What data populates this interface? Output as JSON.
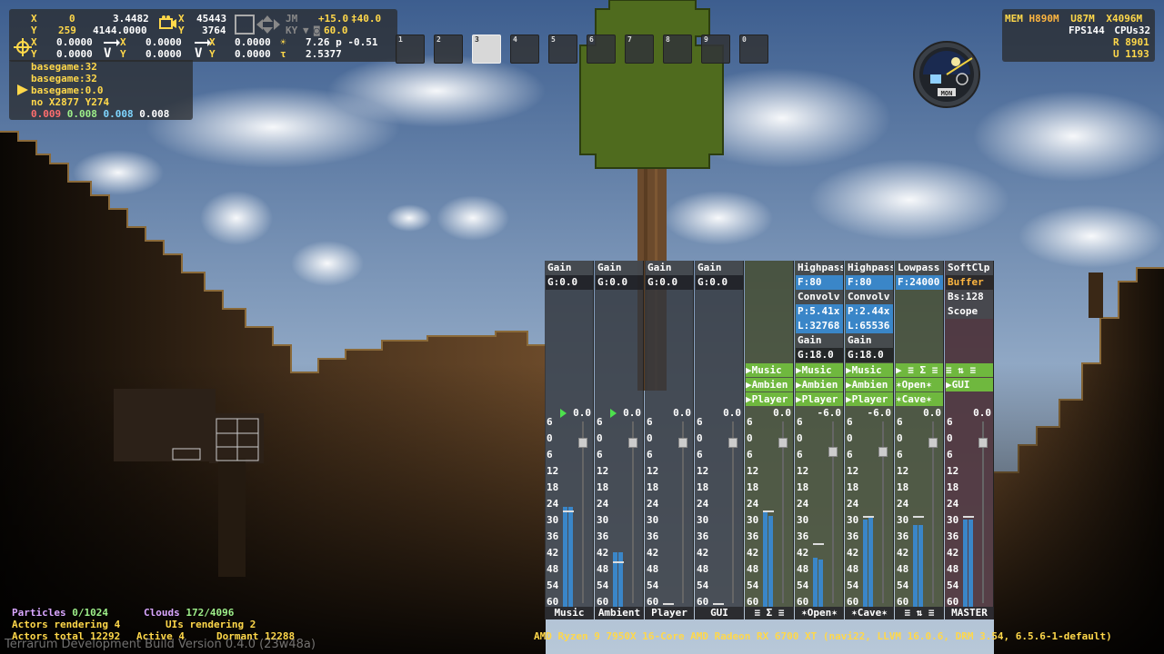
{
  "debug": {
    "row1": {
      "x_label": "X",
      "x_a": "0",
      "x_b": "3.4482",
      "y_label": "Y",
      "y_a": "259",
      "y_b": "4144.0000"
    },
    "row2": {
      "x_label": "X",
      "x_val": "0.0000",
      "y_label": "Y",
      "y_val": "0.0000"
    },
    "cam": {
      "x_label": "X",
      "x_val": "45443",
      "y_label": "Y",
      "y_val": "3764"
    },
    "jm": "JM",
    "ky": "KY",
    "vel1": {
      "x_val": "0.0000",
      "y_val": "0.0000"
    },
    "vel2": {
      "x_val": "0.0000",
      "y_val": "0.0000"
    },
    "wx_a": "+15.0",
    "wx_b": "‡40.0",
    "wx_c": "60.0",
    "time1": "7.26 p -0.51",
    "time2": "2.5377",
    "lines": [
      "basegame:32",
      "basegame:32",
      "basegame:0.0"
    ],
    "tile": "no X2877 Y274",
    "timings": [
      "0.009",
      "0.008",
      "0.008",
      "0.008"
    ]
  },
  "stats": {
    "mem_label": "MEM",
    "mem_h": "H890M",
    "mem_u": "U87M",
    "mem_x": "X4096M",
    "fps": "FPS144",
    "cpus": "CPUs32",
    "r": "R 8901",
    "u": "U 1193"
  },
  "clock": {
    "label": "MON"
  },
  "quickslots": [
    "1",
    "2",
    "3",
    "4",
    "5",
    "6",
    "7",
    "8",
    "9",
    "0"
  ],
  "quickslot_selected": 2,
  "mixer": {
    "strips": [
      {
        "name": "Music",
        "fx": [
          {
            "t": "Gain",
            "s": "h"
          },
          {
            "t": "G:0.0",
            "s": "v"
          }
        ],
        "sends": [],
        "db": "0.0",
        "play": true,
        "fader": 0.05,
        "meterL": 0.55,
        "meterR": 0.55,
        "peak": 0.53
      },
      {
        "name": "Ambient",
        "fx": [
          {
            "t": "Gain",
            "s": "h"
          },
          {
            "t": "G:0.0",
            "s": "v"
          }
        ],
        "sends": [],
        "db": "0.0",
        "play": true,
        "fader": 0.05,
        "meterL": 0.3,
        "meterR": 0.3,
        "peak": 0.25
      },
      {
        "name": "Player",
        "fx": [
          {
            "t": "Gain",
            "s": "h"
          },
          {
            "t": "G:0.0",
            "s": "v"
          }
        ],
        "sends": [],
        "db": "0.0",
        "play": false,
        "fader": 0.05,
        "meterL": 0.0,
        "meterR": 0.0,
        "peak": 0.02
      },
      {
        "name": "GUI",
        "fx": [
          {
            "t": "Gain",
            "s": "h"
          },
          {
            "t": "G:0.0",
            "s": "v"
          }
        ],
        "sends": [],
        "db": "0.0",
        "play": false,
        "fader": 0.05,
        "meterL": 0.0,
        "meterR": 0.0,
        "peak": 0.02
      },
      {
        "name": "≡ Σ ≡",
        "fx": [],
        "sends": [
          "▶Music",
          "▶Ambien",
          "▶Player"
        ],
        "db": "0.0",
        "play": false,
        "fader": 0.05,
        "meterL": 0.52,
        "meterR": 0.5,
        "peak": 0.53
      },
      {
        "name": "✶Open✶",
        "fx": [
          {
            "t": "Highpass",
            "s": "h"
          },
          {
            "t": "F:80",
            "s": "b"
          },
          {
            "t": "Convolv",
            "s": "h"
          },
          {
            "t": "P:5.41x",
            "s": "b"
          },
          {
            "t": "L:32768",
            "s": "b"
          },
          {
            "t": "Gain",
            "s": "h"
          },
          {
            "t": "G:18.0",
            "s": "v"
          }
        ],
        "sends": [
          "▶Music",
          "▶Ambien",
          "▶Player"
        ],
        "db": "-6.0",
        "play": false,
        "fader": 0.15,
        "meterL": 0.27,
        "meterR": 0.26,
        "peak": 0.35
      },
      {
        "name": "✶Cave✶",
        "fx": [
          {
            "t": "Highpass",
            "s": "h"
          },
          {
            "t": "F:80",
            "s": "b"
          },
          {
            "t": "Convolv",
            "s": "h"
          },
          {
            "t": "P:2.44x",
            "s": "b"
          },
          {
            "t": "L:65536",
            "s": "b"
          },
          {
            "t": "Gain",
            "s": "h"
          },
          {
            "t": "G:18.0",
            "s": "v"
          }
        ],
        "sends": [
          "▶Music",
          "▶Ambien",
          "▶Player"
        ],
        "db": "-6.0",
        "play": false,
        "fader": 0.15,
        "meterL": 0.48,
        "meterR": 0.5,
        "peak": 0.5
      },
      {
        "name": "≡ ⇅ ≡",
        "fx": [
          {
            "t": "Lowpass",
            "s": "h"
          },
          {
            "t": "F:24000",
            "s": "b"
          }
        ],
        "sends": [
          "▶ ≡ Σ ≡",
          "✶Open✶",
          "✶Cave✶"
        ],
        "db": "0.0",
        "play": false,
        "fader": 0.05,
        "meterL": 0.45,
        "meterR": 0.45,
        "peak": 0.5
      },
      {
        "name": "MASTER",
        "fx": [
          {
            "t": "SoftClp",
            "s": "h"
          },
          {
            "t": "Buffer",
            "s": "o"
          },
          {
            "t": "Bs:128",
            "s": "h"
          },
          {
            "t": "Scope",
            "s": "h"
          }
        ],
        "sends": [
          "≡ ⇅ ≡",
          "▶GUI"
        ],
        "db": "0.0",
        "play": false,
        "fader": 0.05,
        "meterL": 0.48,
        "meterR": 0.48,
        "peak": 0.5,
        "master": true
      }
    ],
    "scale": [
      "6",
      "0",
      "6",
      "12",
      "18",
      "24",
      "30",
      "36",
      "42",
      "48",
      "54",
      "60"
    ]
  },
  "bottom": {
    "particles_label": "Particles",
    "particles": "0/1024",
    "clouds_label": "Clouds",
    "clouds": "172/4096",
    "actors_rendering": "Actors rendering 4",
    "uis_rendering": "UIs rendering 2",
    "actors_total": "Actors total 12292",
    "active": "Active 4",
    "dormant": "Dormant 12288",
    "version": "Terrarum Development Build Version 0.4.0 (23w48a)",
    "hw": "AMD Ryzen 9 7950X 16-Core  AMD Radeon RX 6700 XT (navi22, LLVM 16.0.6, DRM 3.54, 6.5.6-1-default)"
  }
}
